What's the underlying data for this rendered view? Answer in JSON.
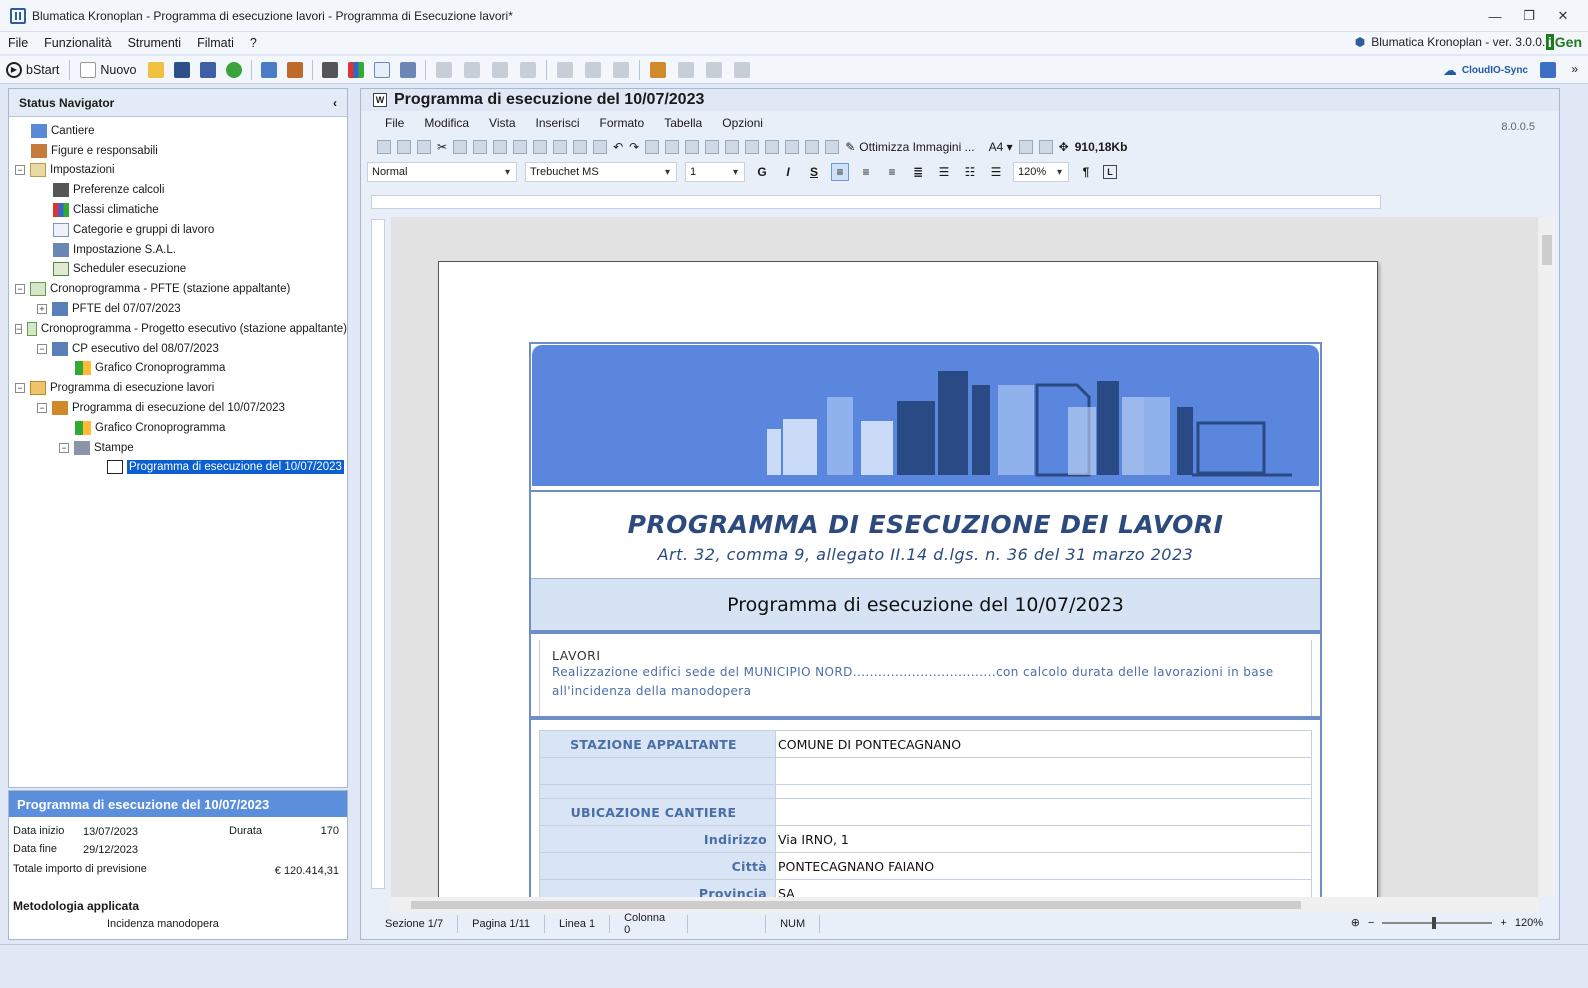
{
  "window": {
    "title": "Blumatica Kronoplan - Programma di esecuzione lavori - Programma di Esecuzione lavori*"
  },
  "menu": {
    "items": [
      "File",
      "Funzionalità",
      "Strumenti",
      "Filmati",
      "?"
    ],
    "version": "Blumatica Kronoplan - ver. 3.0.0.0",
    "gen_logo_a": "i",
    "gen_logo_b": "Gen"
  },
  "toolbar": {
    "bstart": "bStart",
    "nuovo": "Nuovo",
    "cloud": "CloudIO-Sync"
  },
  "nav": {
    "title": "Status Navigator",
    "items": [
      "Cantiere",
      "Figure e responsabili",
      "Impostazioni",
      "Preferenze calcoli",
      "Classi climatiche",
      "Categorie e gruppi di lavoro",
      "Impostazione S.A.L.",
      "Scheduler esecuzione",
      "Cronoprogramma - PFTE (stazione appaltante)",
      "PFTE  del 07/07/2023",
      "Cronoprogramma - Progetto esecutivo (stazione appaltante)",
      "CP esecutivo del 08/07/2023",
      "Grafico Cronoprogramma",
      "Programma di esecuzione lavori",
      "Programma di esecuzione del 10/07/2023",
      "Grafico Cronoprogramma",
      "Stampe",
      "Programma di esecuzione del 10/07/2023"
    ]
  },
  "info": {
    "title": "Programma di esecuzione del 10/07/2023",
    "data_inizio_label": "Data inizio",
    "data_inizio": "13/07/2023",
    "durata_label": "Durata",
    "durata": "170",
    "data_fine_label": "Data fine",
    "data_fine": "29/12/2023",
    "totale_label": "Totale importo di previsione",
    "totale": "€ 120.414,31",
    "metodologia_label": "Metodologia applicata",
    "metodologia": "Incidenza manodopera"
  },
  "editor": {
    "title": "Programma di esecuzione del 10/07/2023",
    "menu": [
      "File",
      "Modifica",
      "Vista",
      "Inserisci",
      "Formato",
      "Tabella",
      "Opzioni"
    ],
    "version": "8.0.0.5",
    "ottimizza": "Ottimizza Immagini ...",
    "paper": "A4",
    "size": "910,18Kb",
    "style": "Normal",
    "font": "Trebuchet MS",
    "fontsize": "1",
    "zoom": "120%"
  },
  "document": {
    "heading": "PROGRAMMA DI ESECUZIONE DEI LAVORI",
    "subheading": "Art. 32, comma 9, allegato II.14 d.lgs. n. 36 del 31 marzo 2023",
    "title": "Programma di esecuzione del 10/07/2023",
    "lavori_label": "LAVORI",
    "lavori_text": "Realizzazione edifici sede del MUNICIPIO NORD..................................con calcolo durata delle lavorazioni in base all'incidenza della manodopera",
    "stazione_label": "STAZIONE APPALTANTE",
    "stazione": "COMUNE DI PONTECAGNANO",
    "ubicazione_label": "UBICAZIONE CANTIERE",
    "indirizzo_label": "Indirizzo",
    "indirizzo": "Via IRNO, 1",
    "citta_label": "Città",
    "citta": "PONTECAGNANO FAIANO",
    "provincia_label": "Provincia",
    "provincia": "SA"
  },
  "status": {
    "sezione": "Sezione 1/7",
    "pagina": "Pagina 1/11",
    "linea": "Linea 1",
    "colonna": "Colonna 0",
    "num": "NUM",
    "zoom": "120%"
  },
  "colors": {
    "accent": "#0b5fd2",
    "banner": "#5a86dd",
    "doc_blue": "#2c4a7e",
    "info_head": "#5b8edb"
  }
}
